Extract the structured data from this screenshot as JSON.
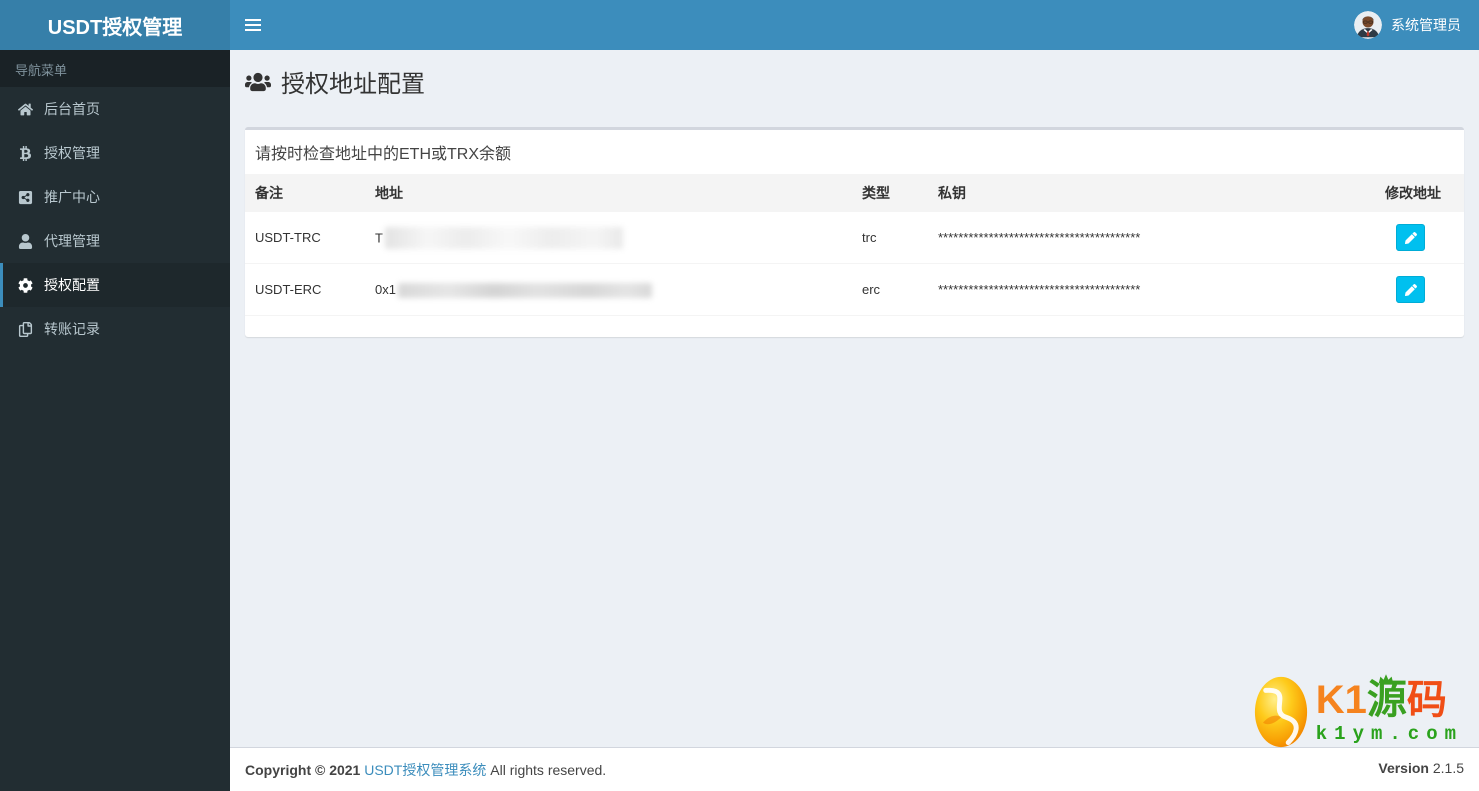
{
  "header": {
    "logo_title": "USDT授权管理",
    "user_name": "系统管理员"
  },
  "sidebar": {
    "section_header": "导航菜单",
    "items": [
      {
        "label": "后台首页",
        "icon": "home-icon",
        "active": false
      },
      {
        "label": "授权管理",
        "icon": "bitcoin-icon",
        "active": false
      },
      {
        "label": "推广中心",
        "icon": "share-icon",
        "active": false
      },
      {
        "label": "代理管理",
        "icon": "user-icon",
        "active": false
      },
      {
        "label": "授权配置",
        "icon": "gear-icon",
        "active": true
      },
      {
        "label": "转账记录",
        "icon": "copy-icon",
        "active": false
      }
    ]
  },
  "page": {
    "title": "授权地址配置"
  },
  "panel": {
    "title": "请按时检查地址中的ETH或TRX余额"
  },
  "table": {
    "headers": [
      "备注",
      "地址",
      "类型",
      "私钥",
      "修改地址"
    ],
    "rows": [
      {
        "remark": "USDT-TRC",
        "address_prefix": "T",
        "address_redacted": true,
        "type": "trc",
        "private_key_masked": "****************************************"
      },
      {
        "remark": "USDT-ERC",
        "address_prefix": "0x1",
        "address_redacted": true,
        "type": "erc",
        "private_key_masked": "****************************************"
      }
    ]
  },
  "footer": {
    "copyright_bold": "Copyright © 2021",
    "brand_link": "USDT授权管理系统",
    "rights_text": "All rights reserved.",
    "version_label": "Version",
    "version_value": "2.1.5"
  },
  "watermark": {
    "brand_part1": "K1",
    "brand_part2": "源",
    "brand_part3": "码",
    "domain": "k1ym.com"
  },
  "colors": {
    "navbar": "#3c8dbc",
    "logo_bg": "#367fa9",
    "sidebar_bg": "#222d32",
    "sidebar_active_bg": "#1e282c",
    "content_bg": "#ecf0f5",
    "edit_button": "#00c0ef",
    "table_head_bg": "#f4f4f4",
    "footer_link": "#3c8dbc"
  }
}
